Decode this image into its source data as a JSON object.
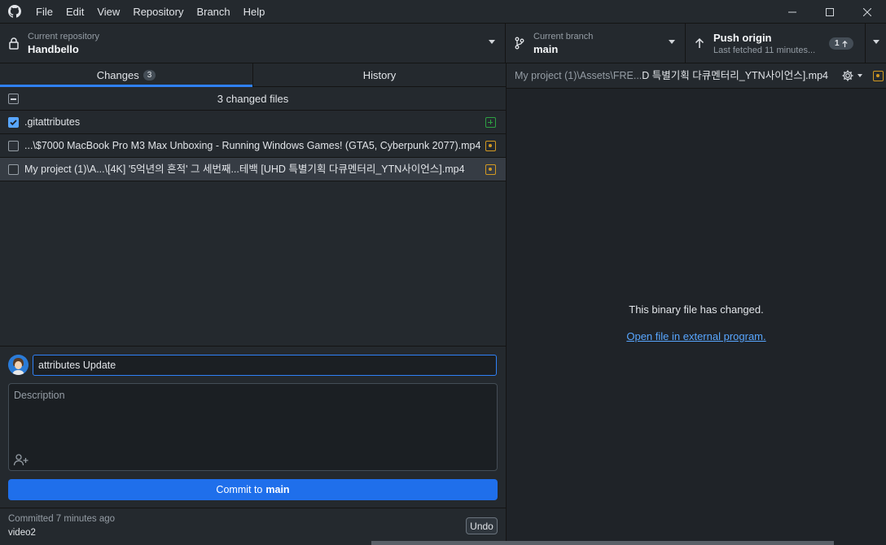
{
  "menu": [
    "File",
    "Edit",
    "View",
    "Repository",
    "Branch",
    "Help"
  ],
  "toolbar": {
    "repo_label": "Current repository",
    "repo_name": "Handbello",
    "branch_label": "Current branch",
    "branch_name": "main",
    "push_title": "Push origin",
    "push_sub": "Last fetched 11 minutes...",
    "push_count": "1"
  },
  "tabs": {
    "changes": "Changes",
    "changes_count": "3",
    "history": "History"
  },
  "changes": {
    "header": "3 changed files",
    "files": [
      {
        "name": ".gitattributes",
        "status": "added",
        "checked": true
      },
      {
        "name": "...\\$7000 MacBook Pro M3 Max Unboxing - Running Windows Games! (GTA5, Cyberpunk 2077).mp4",
        "status": "modified",
        "checked": false
      },
      {
        "name": "My project (1)\\A...\\[4K] '5억년의 흔적' 그 세번째...테백 [UHD 특별기획 다큐멘터리_YTN사이언스].mp4",
        "status": "modified",
        "checked": false
      }
    ]
  },
  "commit": {
    "summary_value": "attributes Update",
    "description_placeholder": "Description",
    "button_prefix": "Commit to",
    "button_branch": "main"
  },
  "last_commit": {
    "time": "Committed 7 minutes ago",
    "message": "video2",
    "undo": "Undo"
  },
  "diff": {
    "path_dim": "My project (1)\\Assets\\FRE...",
    "path_bright": "D 특별기획 다큐멘터리_YTN사이언스].mp4",
    "binary_message": "This binary file has changed.",
    "open_link": "Open file in external program."
  },
  "colors": {
    "accent": "#1f6feb",
    "added": "#2ea043",
    "modified": "#d29922",
    "link": "#58a6ff"
  }
}
